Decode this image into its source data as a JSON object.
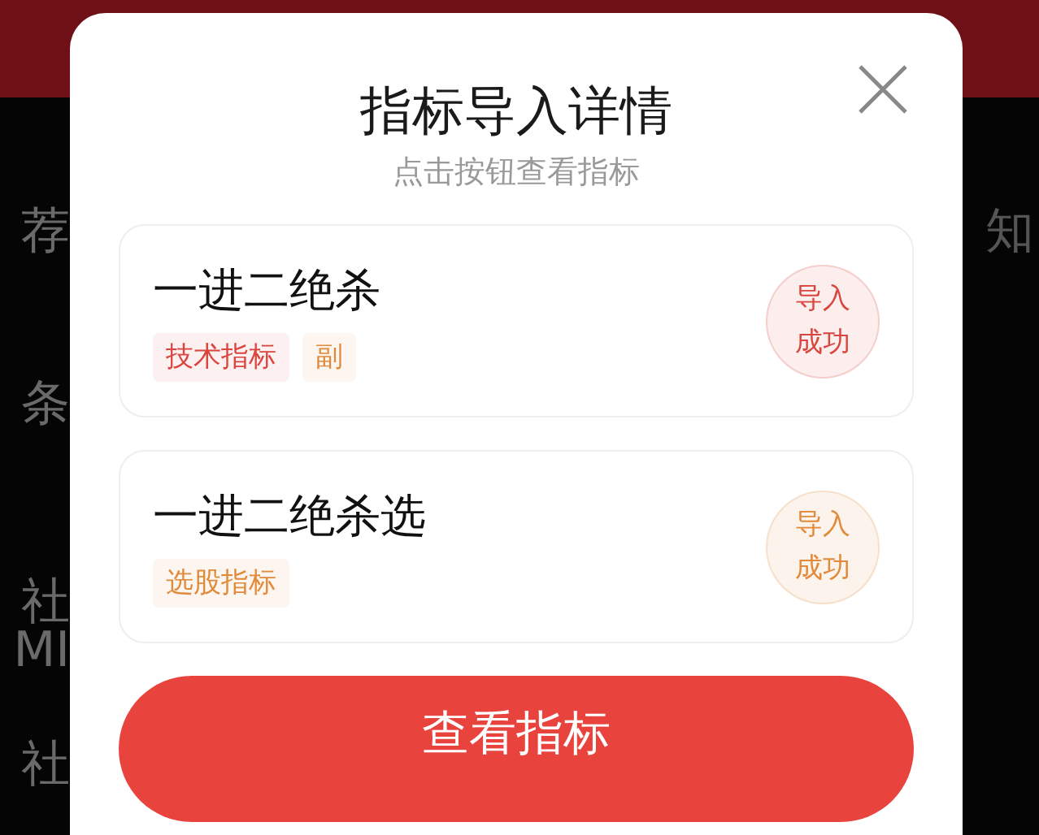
{
  "background": {
    "left_texts": [
      "荐",
      "条",
      "社",
      "MI",
      "社"
    ],
    "right_texts": [
      "知"
    ]
  },
  "dialog": {
    "title": "指标导入详情",
    "subtitle": "点击按钮查看指标",
    "items": [
      {
        "name": "一进二绝杀",
        "tags": [
          {
            "label": "技术指标",
            "color": "#d9463f"
          },
          {
            "label": "副",
            "color": "#e08a3a"
          }
        ],
        "status": "导入成功",
        "color": "#d9463f"
      },
      {
        "name": "一进二绝杀选",
        "tags": [
          {
            "label": "选股指标",
            "color": "#e08a3a"
          }
        ],
        "status": "导入成功",
        "color": "#e08a3a"
      }
    ],
    "button": "查看指标"
  }
}
